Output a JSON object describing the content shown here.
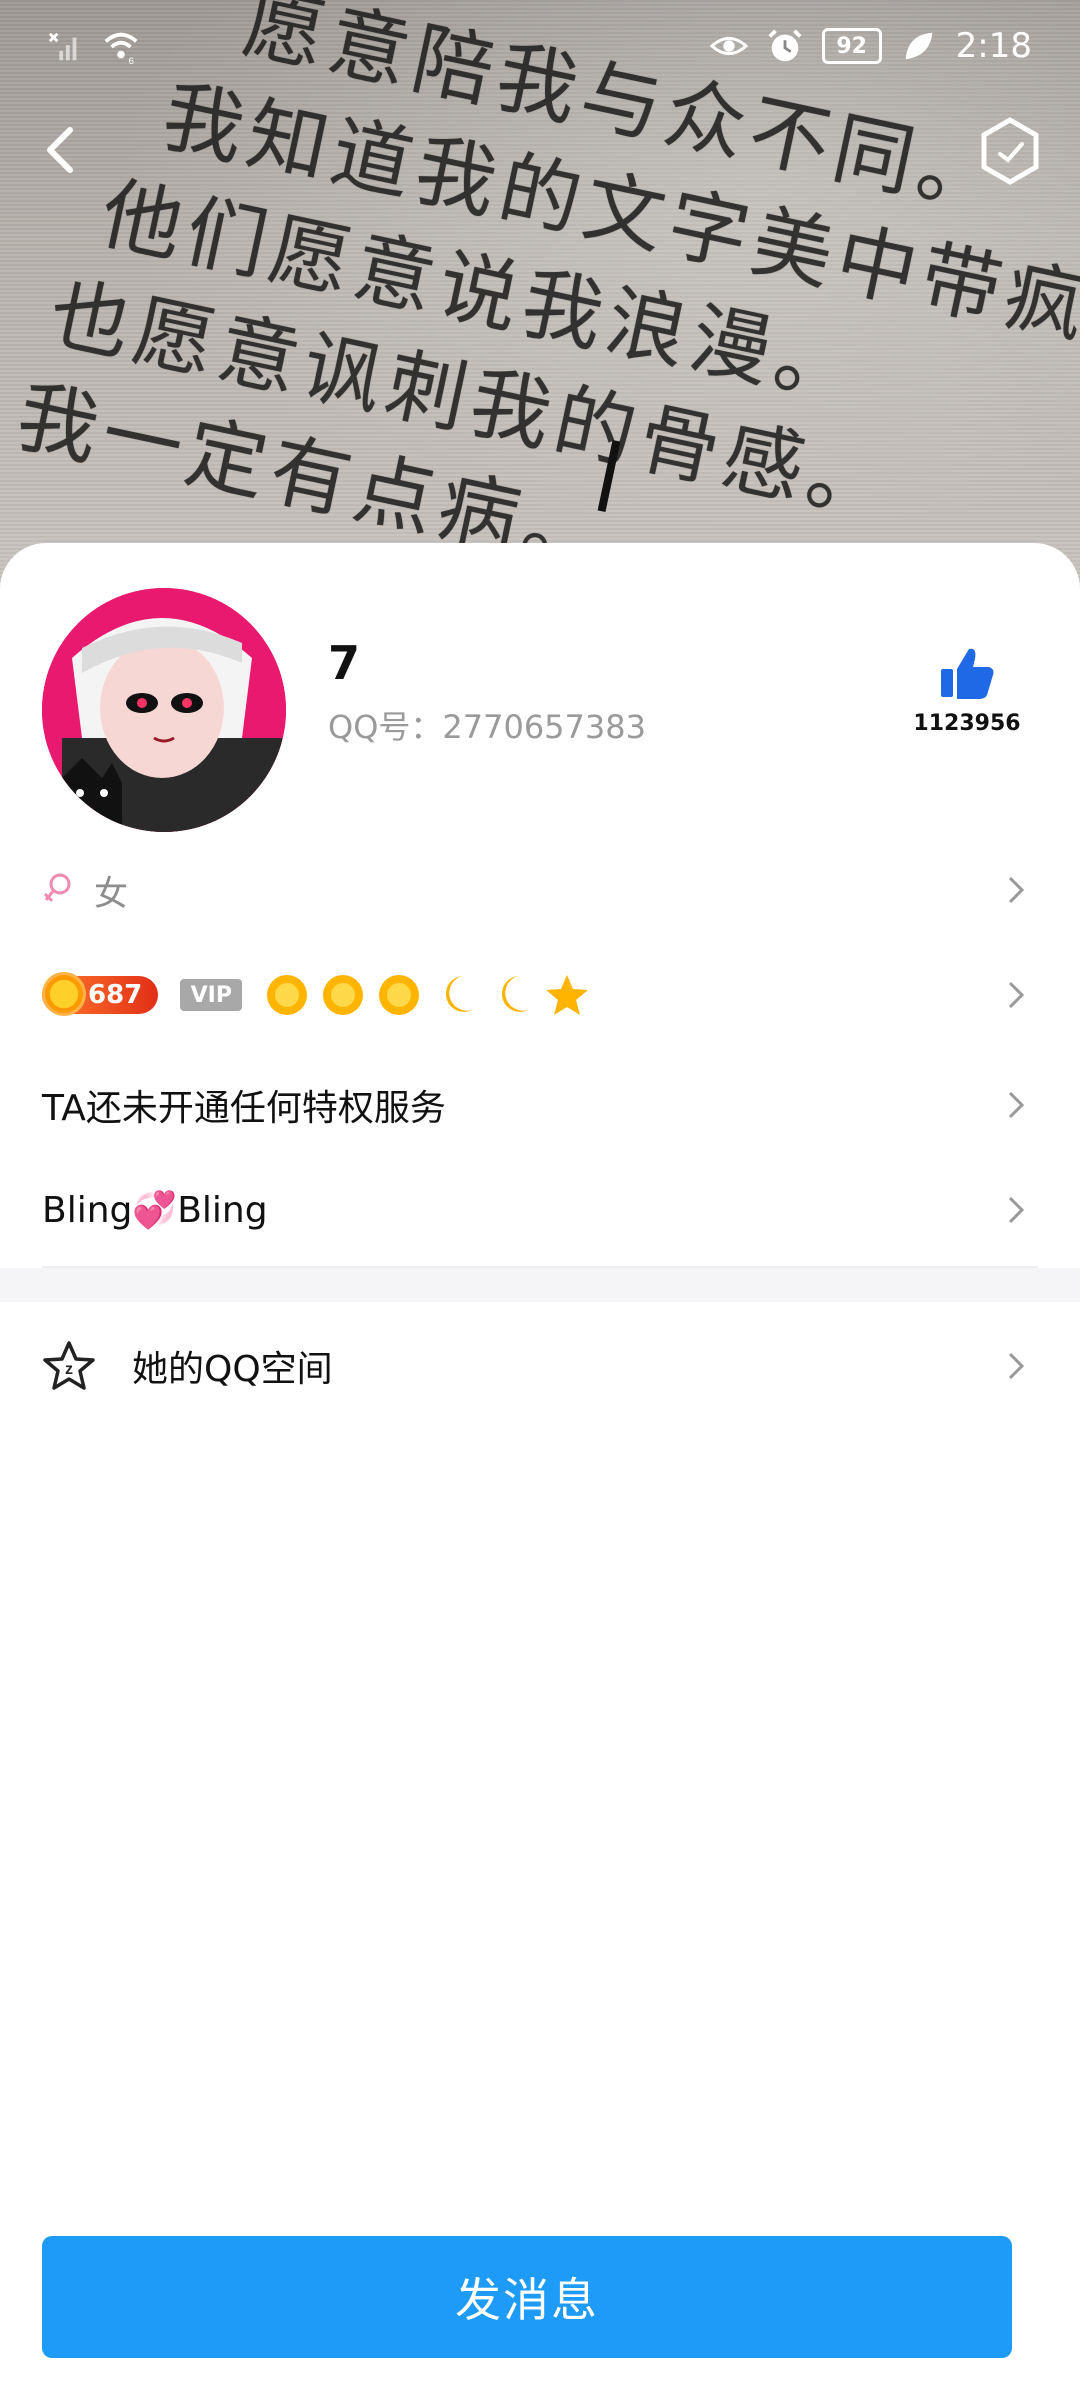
{
  "status_bar": {
    "time": "2:18",
    "battery": "92",
    "icons": [
      "signal-off-icon",
      "wifi-icon",
      "eye-icon",
      "alarm-icon",
      "battery-icon",
      "leaf-icon"
    ]
  },
  "cover": {
    "lines": [
      "我知道我的文字美中带疯。",
      "他们愿意说我浪漫。",
      "也愿意讽刺我的骨感。",
      "我一定有点病。"
    ],
    "top_partial": "愿意陪我与众不同。"
  },
  "profile": {
    "name": "7",
    "qq_label": "QQ号：2770657383",
    "likes": "1123956",
    "gender": "女"
  },
  "level": {
    "value": "687",
    "vip_label": "VIP",
    "medals": [
      "sun",
      "sun",
      "sun",
      "moon",
      "moon",
      "star"
    ]
  },
  "privilege_text": "TA还未开通任何特权服务",
  "signature": "Bling💞Bling",
  "qzone_label": "她的QQ空间",
  "send_button": "发消息",
  "colors": {
    "accent": "#1d9bf7",
    "like_icon": "#1f68e6",
    "avatar_bg": "#e8196f",
    "level_badge": "#e22f18"
  }
}
